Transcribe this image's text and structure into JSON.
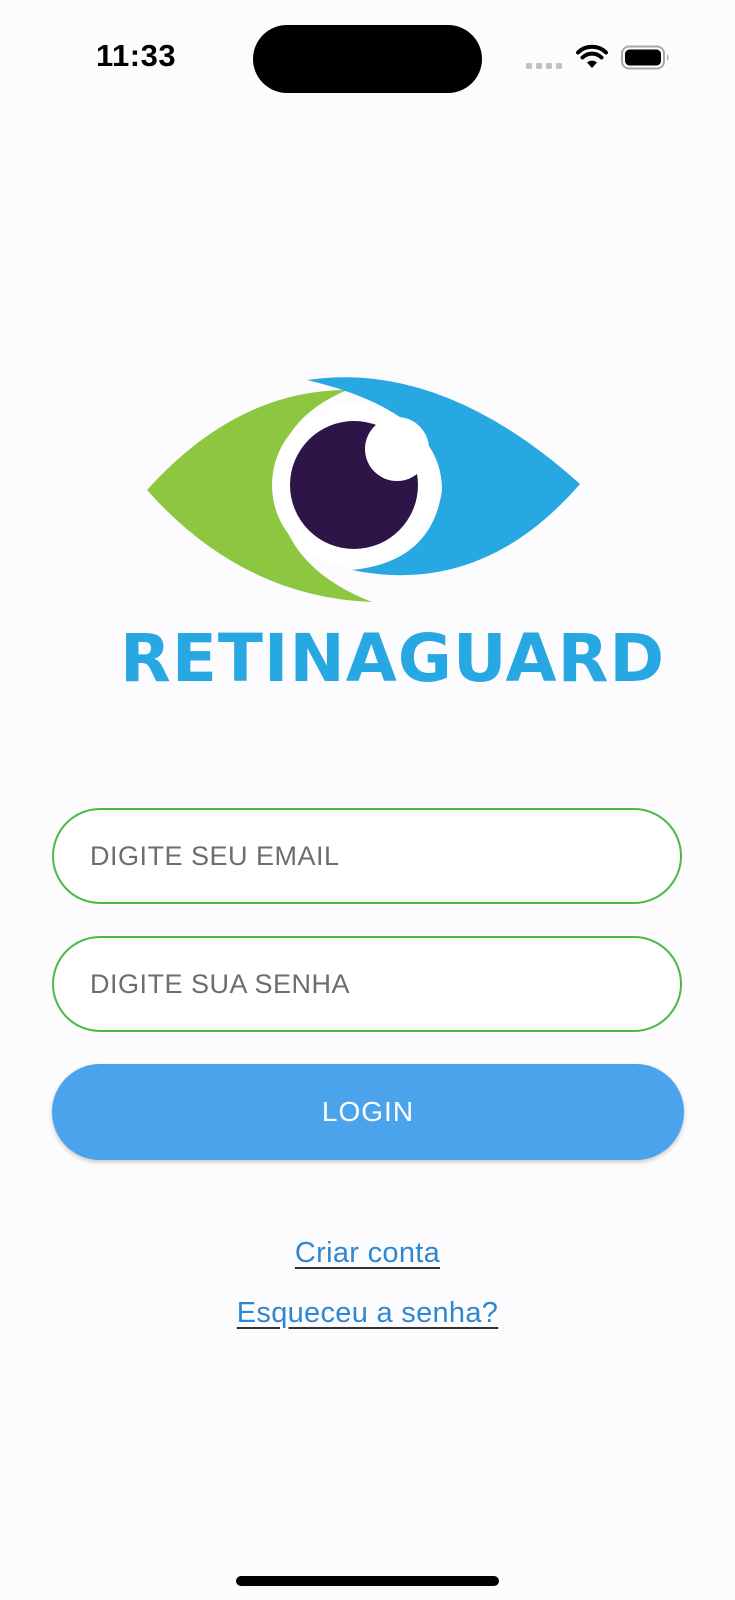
{
  "status_bar": {
    "time": "11:33"
  },
  "logo": {
    "text": "RETINAGUARD",
    "colors": {
      "green": "#8dc63f",
      "blue": "#27a8e3",
      "pupil": "#2e1548"
    }
  },
  "form": {
    "email": {
      "placeholder": "DIGITE SEU EMAIL",
      "value": ""
    },
    "password": {
      "placeholder": "DIGITE SUA SENHA",
      "value": ""
    },
    "login_label": "LOGIN"
  },
  "links": {
    "create_account": "Criar conta",
    "forgot_password": "Esqueceu a senha?"
  },
  "colors": {
    "field_border": "#4cb848",
    "button": "#4ba3ec",
    "link": "#2f87cf"
  }
}
